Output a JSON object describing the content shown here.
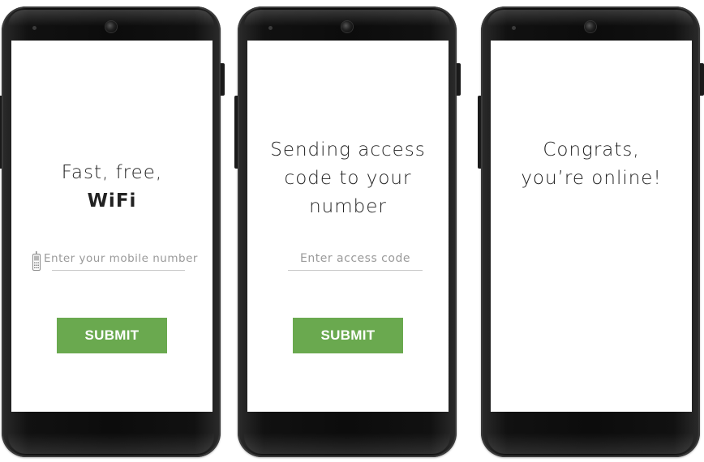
{
  "screens": [
    {
      "headline": "Fast, free,",
      "headline_bold": "WiFi",
      "input_placeholder": "Enter your mobile number",
      "button_label": "SUBMIT"
    },
    {
      "headline_lines": [
        "Sending access",
        "code to your",
        "number"
      ],
      "input_placeholder": "Enter access code",
      "button_label": "SUBMIT"
    },
    {
      "headline_lines": [
        "Congrats,",
        "you’re online!"
      ]
    }
  ],
  "colors": {
    "button_bg": "#6aa94f",
    "button_text": "#ffffff",
    "device_body": "#111111",
    "placeholder": "#9a9a9a"
  },
  "icons": {
    "mobile_field_icon": "mobile-phone-icon"
  }
}
